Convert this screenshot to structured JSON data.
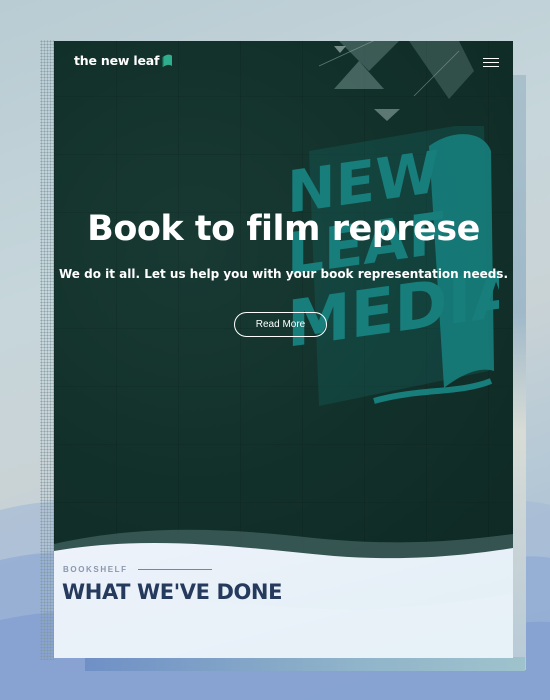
{
  "site": {
    "logo_text": "the new leaf",
    "logo_icon": "leaf-book-icon",
    "menu_icon": "hamburger-menu-icon"
  },
  "hero": {
    "title": "Book to film represe",
    "subtitle": "We do it all. Let us help you with your book representation needs.",
    "cta_label": "Read More",
    "brand_art_text": "NEW LEAF MEDIA"
  },
  "bookshelf": {
    "kicker": "BOOKSHELF",
    "heading": "WHAT WE'VE DONE"
  },
  "colors": {
    "hero_background": "#13312b",
    "brand_teal": "#177e7c",
    "heading_navy": "#263a5d",
    "kicker_gray": "#8a97ad",
    "accent_line": "#4d9aa0"
  }
}
